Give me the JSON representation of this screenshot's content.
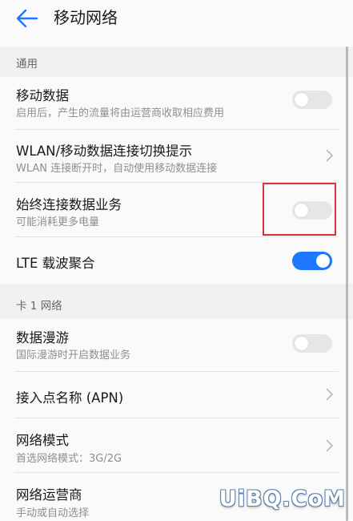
{
  "header": {
    "title": "移动网络"
  },
  "sections": {
    "general": "通用",
    "card1": "卡 1 网络"
  },
  "rows": {
    "mobile_data": {
      "title": "移动数据",
      "subtitle": "启用后，产生的流量将由运营商收取相应费用",
      "toggle_on": false
    },
    "wlan_switch": {
      "title": "WLAN/移动数据连接切换提示",
      "subtitle": "WLAN 连接断开时，自动使用移动数据连接"
    },
    "always_on": {
      "title": "始终连接数据业务",
      "subtitle": "可能消耗更多电量",
      "toggle_on": false
    },
    "lte_ca": {
      "title": "LTE 载波聚合",
      "toggle_on": true
    },
    "roaming": {
      "title": "数据漫游",
      "subtitle": "国际漫游时开启数据业务",
      "toggle_on": false
    },
    "apn": {
      "title": "接入点名称 (APN)"
    },
    "network_mode": {
      "title": "网络模式",
      "subtitle": "首选网络模式：3G/2G"
    },
    "carrier": {
      "title": "网络运营商",
      "subtitle": "手动或自动选择"
    }
  },
  "watermark": "UiBQ.CoM",
  "colors": {
    "accent": "#1e78ff",
    "highlight": "#d9323f"
  },
  "icons": {
    "back": "arrow-left-icon",
    "chevron": "chevron-right-icon"
  }
}
